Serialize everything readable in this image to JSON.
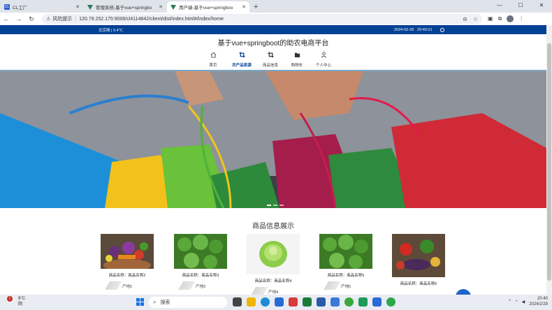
{
  "browser": {
    "tabs": [
      {
        "label": "CL工厂",
        "icon": "cl-favicon-icon",
        "active": false
      },
      {
        "label": "管理系统-基于vue+springbo",
        "icon": "vue-favicon-icon",
        "active": false
      },
      {
        "label": "用户端-基于vue+springboo",
        "icon": "vue-favicon-icon",
        "active": true
      }
    ],
    "new_tab": "+",
    "security_label": "风险提示",
    "url": "120.79.252.175:9006/cl4114842/client/dist/index.html#/index/home"
  },
  "page": {
    "topbar": {
      "weather": "北京晴 | 0.4℃",
      "date": "2024-02-29",
      "time": "20:40:21"
    },
    "site_title": "基于vue+springboot的助农电商平台",
    "nav": [
      {
        "label": "首页",
        "icon": "home-icon",
        "active": false
      },
      {
        "label": "农产品资源",
        "icon": "crop-icon",
        "active": true
      },
      {
        "label": "商品信息",
        "icon": "crop-icon",
        "active": false
      },
      {
        "label": "购物车",
        "icon": "folder-icon",
        "active": false
      },
      {
        "label": "个人中心",
        "icon": "user-icon",
        "active": false
      }
    ],
    "section_title": "商品信息展示",
    "products": [
      {
        "name": "商品名称：商品名称2",
        "origin": "产地2"
      },
      {
        "name": "商品名称：商品名称3",
        "origin": "产地3"
      },
      {
        "name": "商品名称：商品名称4",
        "origin": "产地4"
      },
      {
        "name": "商品名称：商品名称5",
        "origin": "产地5"
      },
      {
        "name": "商品名称：商品名称6",
        "origin": "产地6"
      }
    ]
  },
  "taskbar": {
    "temp": "9°C",
    "condition": "阴",
    "notification_count": "1",
    "search_placeholder": "搜索",
    "clock_time": "20:40",
    "clock_date": "2024/2/29"
  },
  "colors": {
    "brand": "#034194",
    "accent": "#1f63c9"
  }
}
